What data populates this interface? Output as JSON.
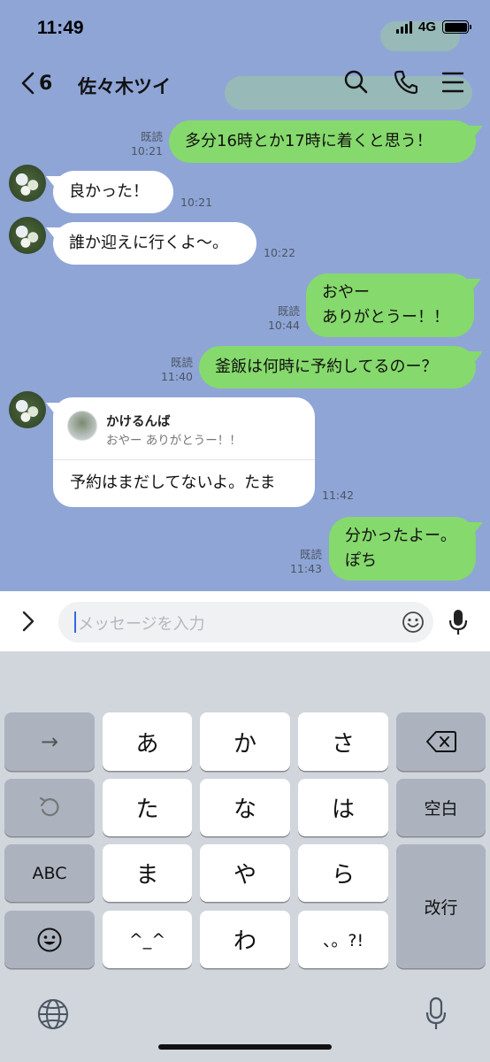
{
  "status_bar": {
    "time": "11:49",
    "network": "4G"
  },
  "header": {
    "back_count": "6",
    "title": "佐々木ツイ"
  },
  "messages": [
    {
      "text": "多分16時とか17時に着くと思う！",
      "read": "既読",
      "time": "10:21"
    },
    {
      "text": "良かった！",
      "time": "10:21"
    },
    {
      "text": "誰か迎えに行くよ〜。",
      "time": "10:22"
    },
    {
      "line1": "おやー",
      "line2": "ありがとうー！！",
      "read": "既読",
      "time": "10:44"
    },
    {
      "text": "釜飯は何時に予約してるのー？",
      "read": "既読",
      "time": "11:40"
    },
    {
      "reply_name": "かけるんば",
      "reply_quote": "おやー ありがとうー！！",
      "text": "予約はまだしてないよ。たま",
      "time": "11:42"
    },
    {
      "line1": "分かったよー。",
      "line2": "ぽち",
      "read": "既読",
      "time": "11:43"
    }
  ],
  "input": {
    "placeholder": "メッセージを入力"
  },
  "keyboard": {
    "keys": [
      "→",
      "あ",
      "か",
      "さ",
      "た",
      "な",
      "は",
      "空白",
      "ABC",
      "ま",
      "や",
      "ら",
      "改行",
      "^_^",
      "わ",
      "、。?!"
    ]
  },
  "colors": {
    "chat_bg": "#8fa5d6",
    "sent_bubble": "#86d96c",
    "recv_bubble": "#ffffff"
  }
}
